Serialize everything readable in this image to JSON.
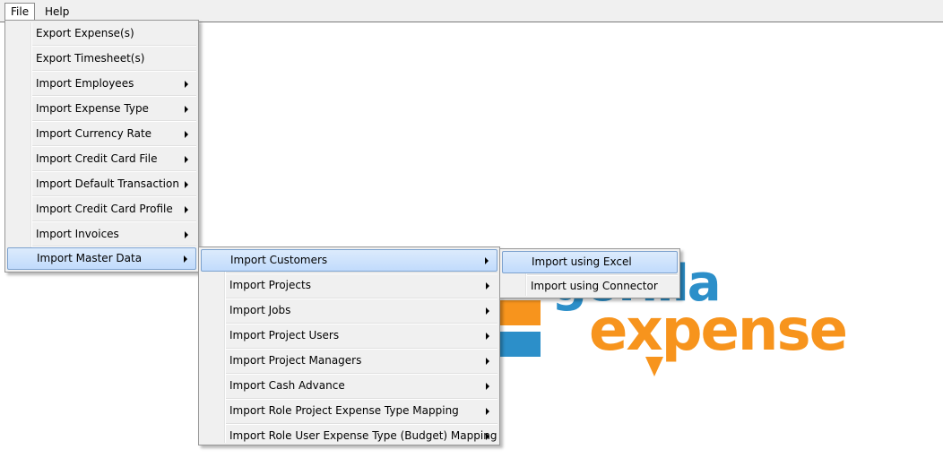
{
  "menubar": {
    "file": "File",
    "help": "Help"
  },
  "file_menu": {
    "items": [
      {
        "label": "Export Expense(s)",
        "submenu": false
      },
      {
        "label": "Export Timesheet(s)",
        "submenu": false
      },
      {
        "label": "Import Employees",
        "submenu": true
      },
      {
        "label": "Import Expense Type",
        "submenu": true
      },
      {
        "label": "Import Currency Rate",
        "submenu": true
      },
      {
        "label": "Import Credit Card File",
        "submenu": true
      },
      {
        "label": "Import Default Transaction",
        "submenu": true
      },
      {
        "label": "Import Credit Card Profile",
        "submenu": true
      },
      {
        "label": "Import Invoices",
        "submenu": true
      },
      {
        "label": "Import Master Data",
        "submenu": true,
        "highlighted": true
      }
    ]
  },
  "master_data_menu": {
    "items": [
      {
        "label": "Import Customers",
        "submenu": true,
        "highlighted": true
      },
      {
        "label": "Import Projects",
        "submenu": true
      },
      {
        "label": "Import Jobs",
        "submenu": true
      },
      {
        "label": "Import Project Users",
        "submenu": true
      },
      {
        "label": "Import Project Managers",
        "submenu": true
      },
      {
        "label": "Import Cash Advance",
        "submenu": true
      },
      {
        "label": "Import Role Project Expense Type Mapping",
        "submenu": true
      },
      {
        "label": "Import Role User Expense Type (Budget) Mapping",
        "submenu": true
      }
    ]
  },
  "customers_menu": {
    "items": [
      {
        "label": "Import using Excel",
        "highlighted": true
      },
      {
        "label": "Import using Connector"
      }
    ]
  },
  "logo": {
    "word1": "gorilla",
    "word2": "expense",
    "blue": "#2c8fc9",
    "orange": "#f7941d"
  },
  "colors": {
    "menu_bg": "#f0f0f0",
    "highlight": "#c1dbfc",
    "highlight_border": "#7da2ce"
  }
}
